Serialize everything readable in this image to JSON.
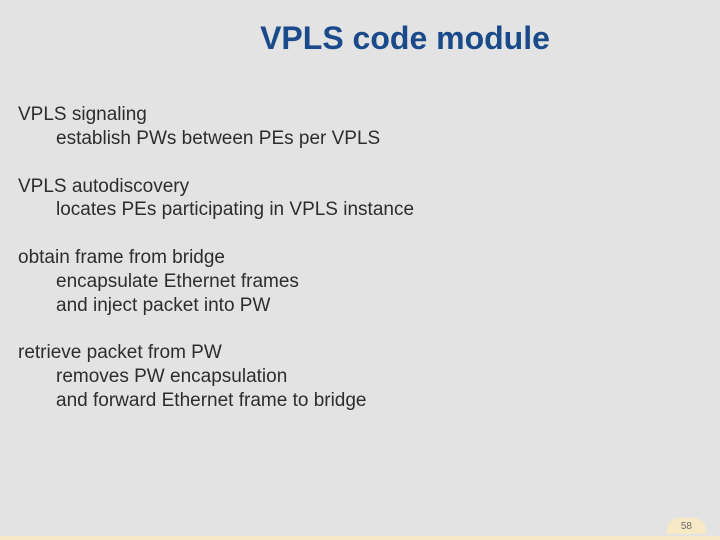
{
  "title": "VPLS code module",
  "sections": [
    {
      "lead": "VPLS signaling",
      "subs": [
        "establish PWs between PEs per VPLS"
      ]
    },
    {
      "lead": "VPLS autodiscovery",
      "subs": [
        "locates PEs participating in VPLS instance"
      ]
    },
    {
      "lead": "obtain frame from bridge",
      "subs": [
        "encapsulate Ethernet frames",
        "and inject packet into PW"
      ]
    },
    {
      "lead": "retrieve packet from PW",
      "subs": [
        "removes PW encapsulation",
        "and forward Ethernet frame to bridge"
      ]
    }
  ],
  "page_number": "58"
}
